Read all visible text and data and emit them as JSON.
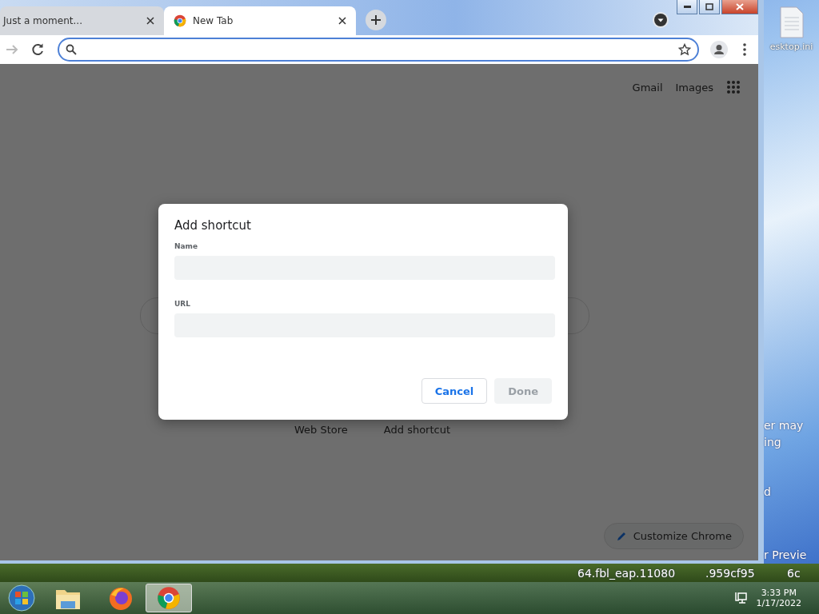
{
  "desktop": {
    "icon_label": "esktop.ini",
    "fragments": [
      "er may",
      "ing",
      "d",
      "r Previe",
      "64.fbl_eap.11080",
      ".959cf95",
      "6c"
    ]
  },
  "browser": {
    "tabs": [
      {
        "title": "Just a moment...",
        "selected": false,
        "favicon": false
      },
      {
        "title": "New Tab",
        "selected": true,
        "favicon": true
      }
    ],
    "forward_disabled": true,
    "address_bar": {
      "focused": true
    },
    "new_tab_page": {
      "links": [
        "Gmail",
        "Images"
      ],
      "shortcuts": [
        "Web Store",
        "Add shortcut"
      ],
      "customize_button": "Customize Chrome"
    }
  },
  "dialog": {
    "title": "Add shortcut",
    "fields": [
      {
        "label": "Name"
      },
      {
        "label": "URL"
      }
    ],
    "buttons": [
      {
        "label": "Cancel",
        "disabled": false
      },
      {
        "label": "Done",
        "disabled": true
      }
    ]
  },
  "taskbar": {
    "apps": [
      {
        "kind": "start",
        "selected": false
      },
      {
        "kind": "explorer",
        "selected": false
      },
      {
        "kind": "firefox",
        "selected": false
      },
      {
        "kind": "chrome",
        "selected": true
      }
    ],
    "time": "3:33 PM",
    "date": "1/17/2022"
  }
}
